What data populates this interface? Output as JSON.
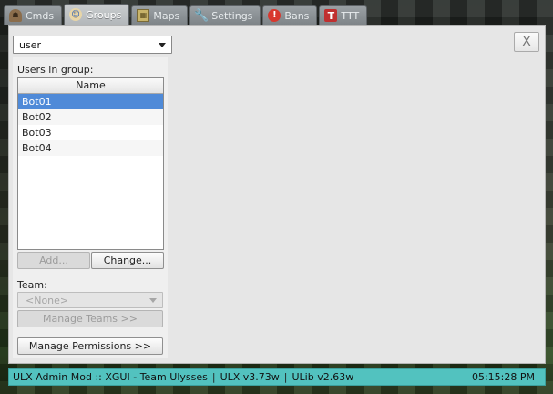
{
  "tabs": [
    {
      "label": "Cmds",
      "icon": "cmds-icon",
      "glyph": "☗",
      "active": false
    },
    {
      "label": "Groups",
      "icon": "groups-icon",
      "glyph": "☺",
      "active": true
    },
    {
      "label": "Maps",
      "icon": "maps-icon",
      "glyph": "▦",
      "active": false
    },
    {
      "label": "Settings",
      "icon": "wrench-icon",
      "glyph": "🔧",
      "active": false
    },
    {
      "label": "Bans",
      "icon": "bans-icon",
      "glyph": "!",
      "active": false
    },
    {
      "label": "TTT",
      "icon": "ttt-icon",
      "glyph": "T",
      "active": false
    }
  ],
  "panel": {
    "close_label": "X",
    "group_select_value": "user",
    "users_label": "Users in group:",
    "list_header": "Name",
    "users": [
      "Bot01",
      "Bot02",
      "Bot03",
      "Bot04"
    ],
    "selected_user": "Bot01",
    "add_button": "Add...",
    "change_button": "Change...",
    "team_label": "Team:",
    "team_select_value": "<None>",
    "manage_teams_button": "Manage Teams >>",
    "manage_permissions_button": "Manage Permissions >>"
  },
  "statusbar": {
    "title": "ULX Admin Mod :: XGUI - Team Ulysses",
    "ulx_version": "ULX v3.73w",
    "ulib_version": "ULib v2.63w",
    "time": "05:15:28 PM",
    "separator": "|"
  },
  "colors": {
    "statusbar": "#52c2bf",
    "selection": "#4f8ad8",
    "panel": "#e6e6e6"
  }
}
